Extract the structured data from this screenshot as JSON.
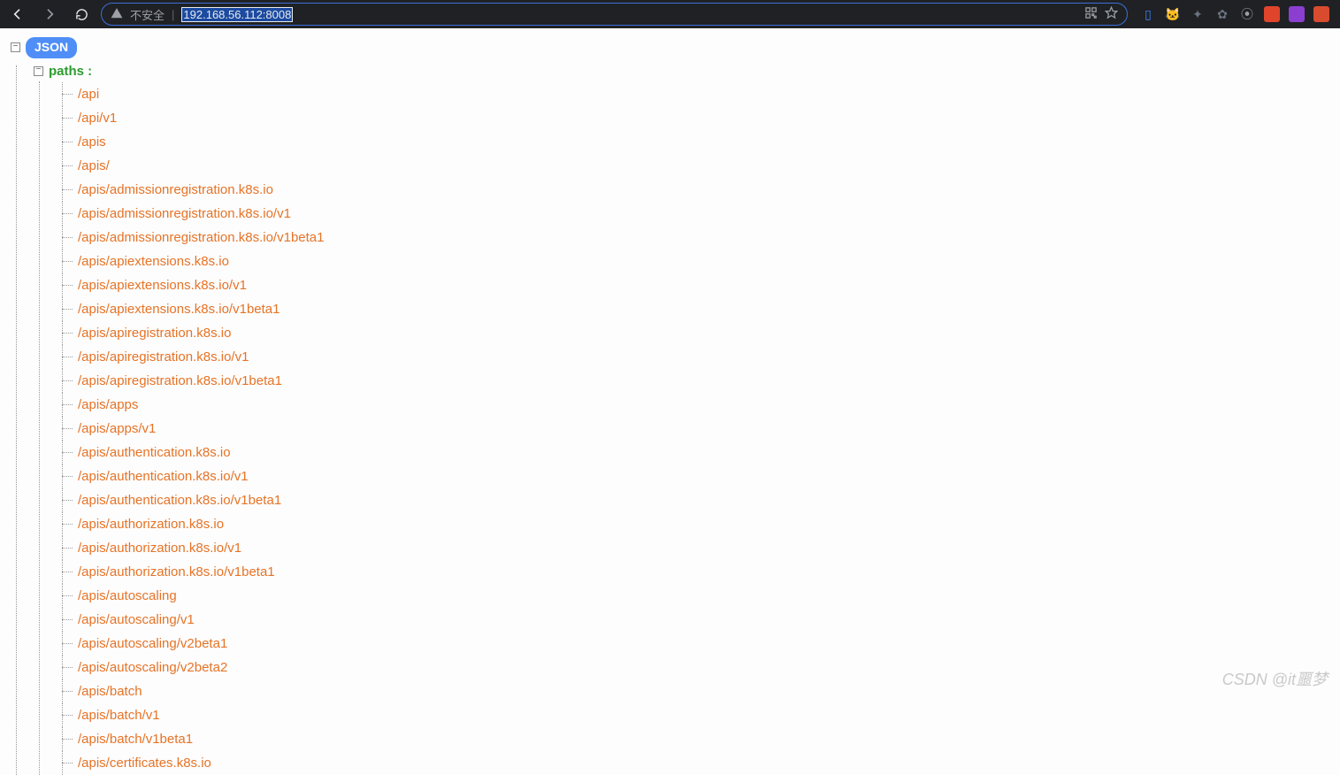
{
  "chrome": {
    "insecure_label": "不安全",
    "url": "192.168.56.112:8008"
  },
  "tree": {
    "root_badge": "JSON",
    "paths_label": "paths :",
    "items": [
      "/api",
      "/api/v1",
      "/apis",
      "/apis/",
      "/apis/admissionregistration.k8s.io",
      "/apis/admissionregistration.k8s.io/v1",
      "/apis/admissionregistration.k8s.io/v1beta1",
      "/apis/apiextensions.k8s.io",
      "/apis/apiextensions.k8s.io/v1",
      "/apis/apiextensions.k8s.io/v1beta1",
      "/apis/apiregistration.k8s.io",
      "/apis/apiregistration.k8s.io/v1",
      "/apis/apiregistration.k8s.io/v1beta1",
      "/apis/apps",
      "/apis/apps/v1",
      "/apis/authentication.k8s.io",
      "/apis/authentication.k8s.io/v1",
      "/apis/authentication.k8s.io/v1beta1",
      "/apis/authorization.k8s.io",
      "/apis/authorization.k8s.io/v1",
      "/apis/authorization.k8s.io/v1beta1",
      "/apis/autoscaling",
      "/apis/autoscaling/v1",
      "/apis/autoscaling/v2beta1",
      "/apis/autoscaling/v2beta2",
      "/apis/batch",
      "/apis/batch/v1",
      "/apis/batch/v1beta1",
      "/apis/certificates.k8s.io"
    ]
  },
  "watermark": "CSDN @it噩梦"
}
